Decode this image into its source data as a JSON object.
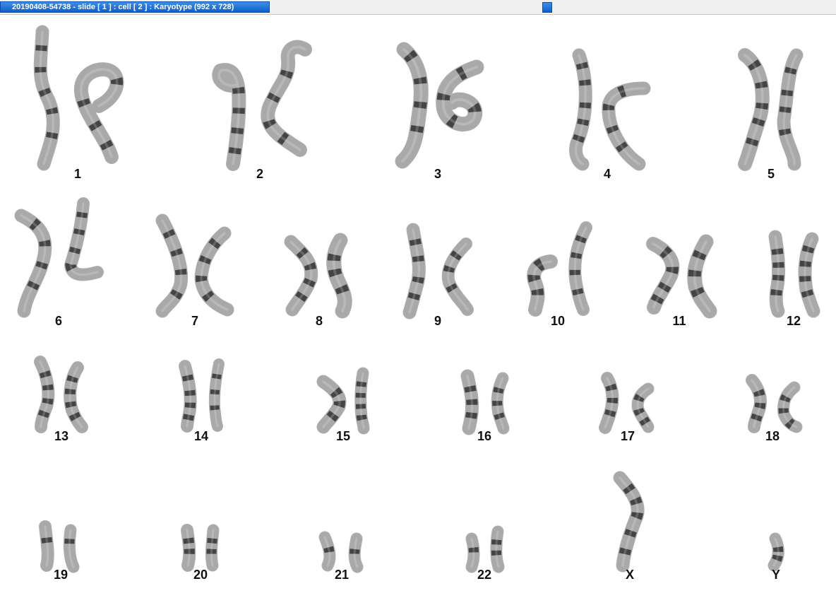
{
  "window": {
    "title": "20190408-54738 - slide [ 1 ] : cell [ 2 ] : Karyotype  (992 x 728)"
  },
  "karyotype": {
    "labels": [
      "1",
      "2",
      "3",
      "4",
      "5",
      "6",
      "7",
      "8",
      "9",
      "10",
      "11",
      "12",
      "13",
      "14",
      "15",
      "16",
      "17",
      "18",
      "19",
      "20",
      "21",
      "22",
      "X",
      "Y"
    ]
  },
  "colors": {
    "chromosome_body": "#a9a9a9",
    "band": "#2a2a2a",
    "title_tab": "#1565d8"
  }
}
